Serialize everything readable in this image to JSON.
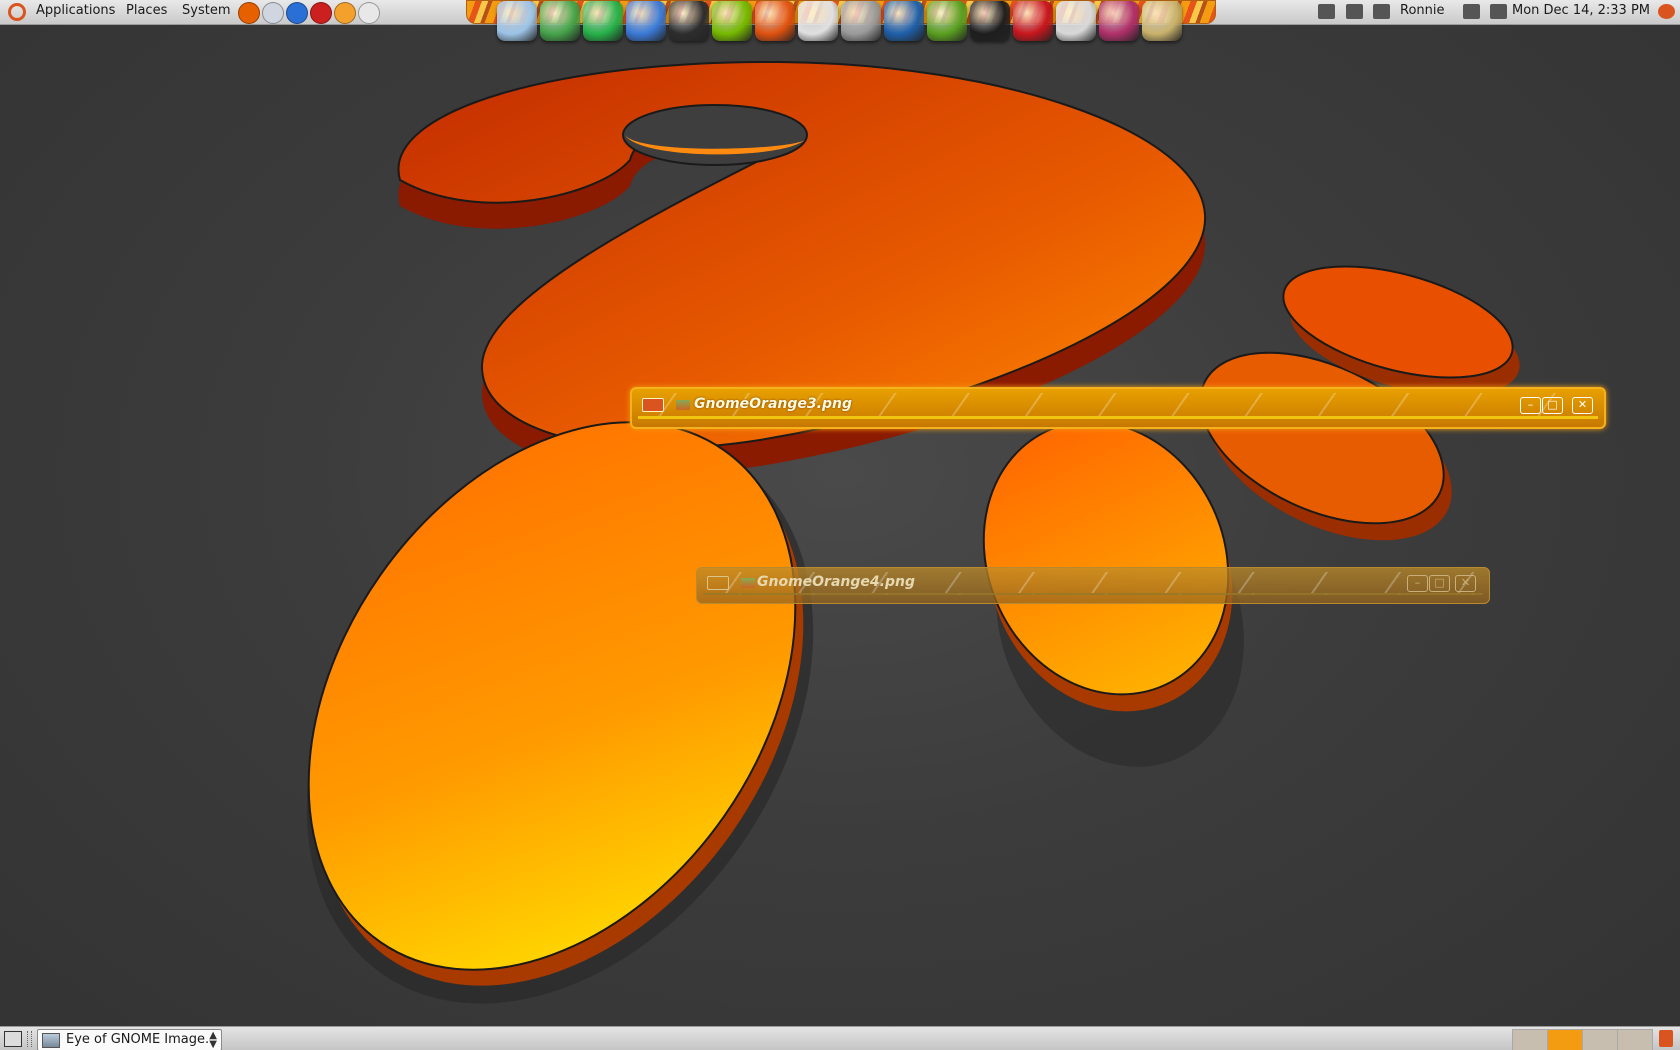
{
  "top_panel": {
    "menus": [
      "Applications",
      "Places",
      "System"
    ],
    "user": "Ronnie",
    "clock": "Mon Dec 14,  2:33 PM"
  },
  "quick_launchers": [
    {
      "name": "firefox-icon",
      "color": "#e66000"
    },
    {
      "name": "mail-icon",
      "color": "#d0d6e0"
    },
    {
      "name": "help-icon",
      "color": "#2a6fd6"
    },
    {
      "name": "app-red-icon",
      "color": "#cc1f1f"
    },
    {
      "name": "app-orange-icon",
      "color": "#f3a12c"
    },
    {
      "name": "screenshot-icon",
      "color": "#e8e8e8"
    }
  ],
  "dock_icons": [
    {
      "name": "search-icon",
      "color": "#9cc3e6"
    },
    {
      "name": "chrome-icon",
      "color": "#46a44a"
    },
    {
      "name": "gem-icon",
      "color": "#27b24a"
    },
    {
      "name": "network-icon",
      "color": "#3b7ad6"
    },
    {
      "name": "terminal-icon",
      "color": "#2d2d2d"
    },
    {
      "name": "nvidia-icon",
      "color": "#76b900"
    },
    {
      "name": "firefox-icon",
      "color": "#e0520f"
    },
    {
      "name": "printer-icon",
      "color": "#e0e0e0"
    },
    {
      "name": "calculator-icon",
      "color": "#9a9a9a"
    },
    {
      "name": "google-earth-icon",
      "color": "#1f5fa8"
    },
    {
      "name": "ubuntu-tweak-icon",
      "color": "#5aa020"
    },
    {
      "name": "app-dark-icon",
      "color": "#1e1e1e"
    },
    {
      "name": "acrobat-icon",
      "color": "#c8161d"
    },
    {
      "name": "disk-icon",
      "color": "#d8d8d8"
    },
    {
      "name": "music-icon",
      "color": "#b0306a"
    },
    {
      "name": "webcam-icon",
      "color": "#c9b26b"
    }
  ],
  "tray_icons": [
    {
      "name": "tray-app-icon"
    },
    {
      "name": "tray-display-icon"
    },
    {
      "name": "tray-user-switch-icon"
    },
    {
      "name": "tray-network-icon"
    },
    {
      "name": "tray-volume-icon"
    },
    {
      "name": "power-icon"
    }
  ],
  "windows": [
    {
      "title": "GnomeOrange3.png",
      "active": true
    },
    {
      "title": "GnomeOrange4.png",
      "active": false
    }
  ],
  "bottom_panel": {
    "task_label": "Eye of GNOME Image..",
    "workspaces": 4,
    "active_workspace": 2
  },
  "colors": {
    "accent": "#f39c12",
    "wall_orange": "#ff7a00"
  }
}
